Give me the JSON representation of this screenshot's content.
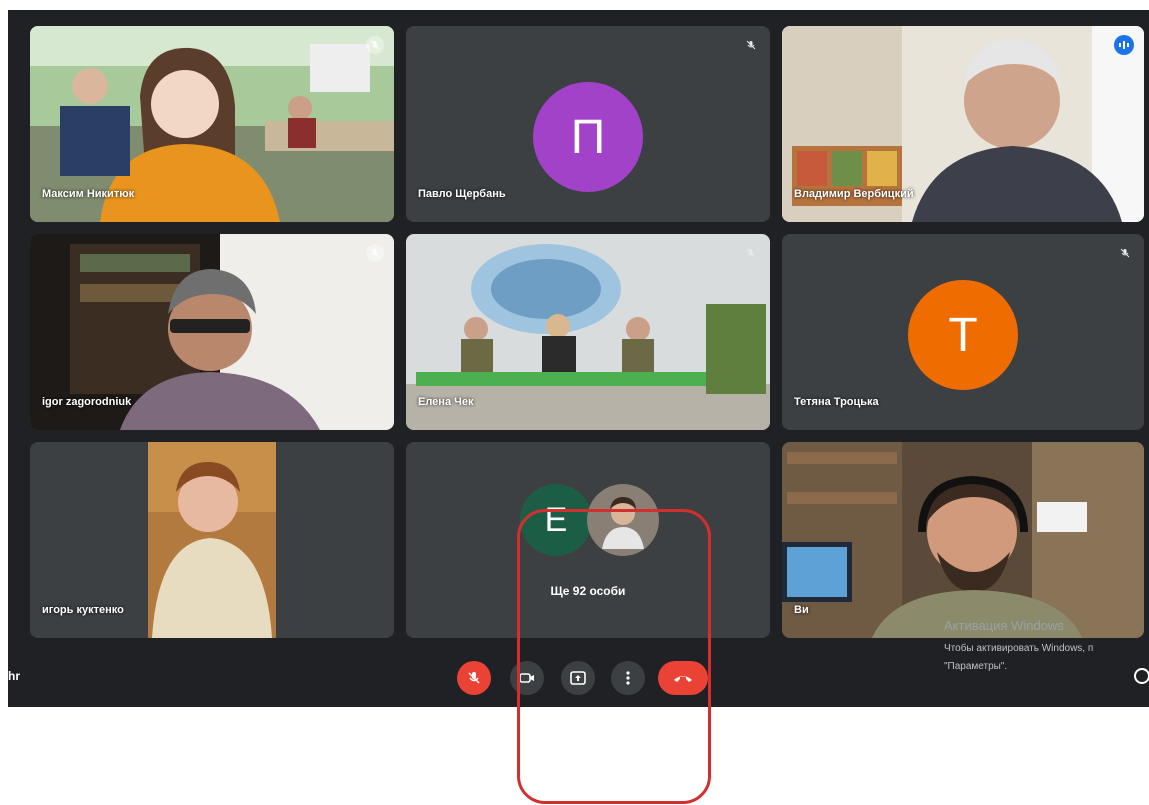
{
  "participants": [
    {
      "name": "Максим Никитюк"
    },
    {
      "name": "Павло Щербань",
      "initial": "П",
      "color": "#a142c8"
    },
    {
      "name": "Владимир Вербицкий"
    },
    {
      "name": "igor zagorodniuk"
    },
    {
      "name": "Елена Чек"
    },
    {
      "name": "Тетяна Троцька",
      "initial": "Т",
      "color": "#ef6c00"
    },
    {
      "name": "игорь куктенко"
    },
    {
      "name": "Ви"
    }
  ],
  "others": {
    "initial": "E",
    "color": "#1b5e45",
    "label": "Ще 92 особи"
  },
  "bottom_left_text": "hr",
  "controls": [
    {
      "icon": "mic-off-icon"
    },
    {
      "icon": "camera-icon"
    },
    {
      "icon": "present-screen-icon"
    },
    {
      "icon": "more-options-icon"
    },
    {
      "icon": "hang-up-icon"
    }
  ],
  "watermark": {
    "line1": "Активация Windows",
    "line2": "Чтобы активировать Windows, п",
    "line3": "\"Параметры\"."
  },
  "colors": {
    "background": "#202124",
    "tile": "#3c4043",
    "accent": "#1a73e8",
    "danger": "#ea4335",
    "highlight": "#d32f2f"
  }
}
